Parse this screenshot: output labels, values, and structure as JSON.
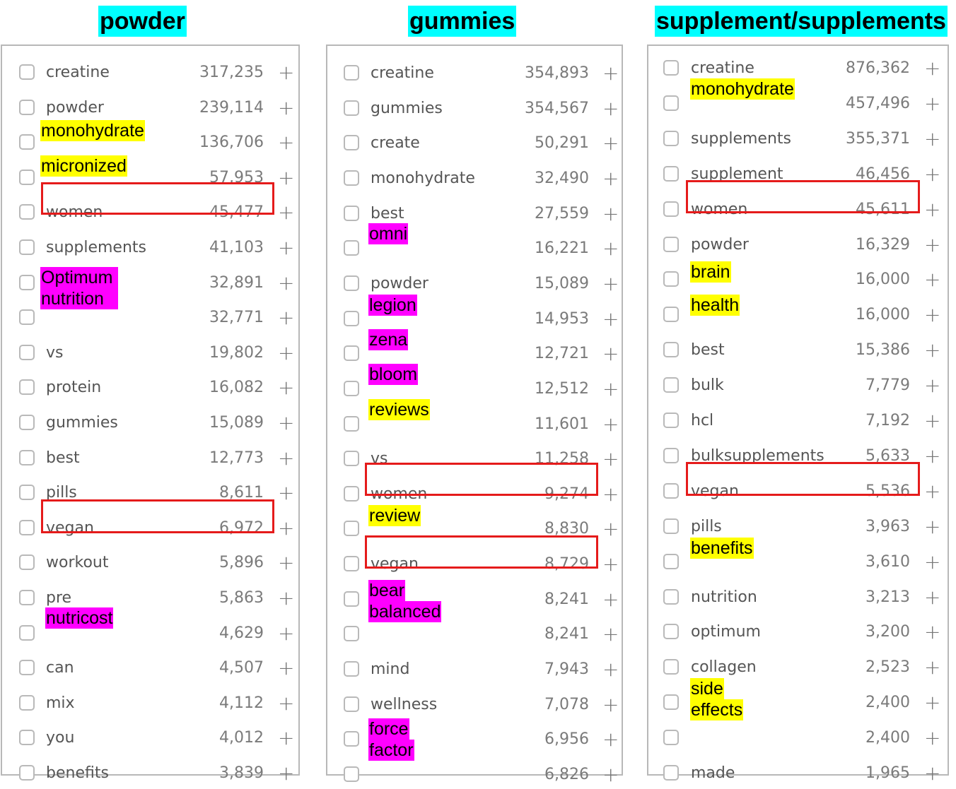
{
  "titles": {
    "powder": "powder",
    "gummies": "gummies",
    "supplements": "supplement/supplements"
  },
  "colors": {
    "title_bg": "#00ffff",
    "yellow": "#ffff00",
    "magenta": "#ff00ff",
    "red_box": "#e51b1b"
  },
  "icons": {
    "checkbox": "checkbox-icon",
    "add": "plus-icon"
  },
  "powder_rows": [
    {
      "keyword": "creatine",
      "count": "317,235"
    },
    {
      "keyword": "powder",
      "count": "239,114"
    },
    {
      "keyword": "",
      "count": "136,706"
    },
    {
      "keyword": "",
      "count": "57,953"
    },
    {
      "keyword": "women",
      "count": "45,477"
    },
    {
      "keyword": "supplements",
      "count": "41,103"
    },
    {
      "keyword": "",
      "count": "32,891"
    },
    {
      "keyword": "",
      "count": "32,771"
    },
    {
      "keyword": "vs",
      "count": "19,802"
    },
    {
      "keyword": "protein",
      "count": "16,082"
    },
    {
      "keyword": "gummies",
      "count": "15,089"
    },
    {
      "keyword": "best",
      "count": "12,773"
    },
    {
      "keyword": "pills",
      "count": "8,611"
    },
    {
      "keyword": "vegan",
      "count": "6,972"
    },
    {
      "keyword": "workout",
      "count": "5,896"
    },
    {
      "keyword": "pre",
      "count": "5,863"
    },
    {
      "keyword": "",
      "count": "4,629"
    },
    {
      "keyword": "can",
      "count": "4,507"
    },
    {
      "keyword": "mix",
      "count": "4,112"
    },
    {
      "keyword": "you",
      "count": "4,012"
    },
    {
      "keyword": "benefits",
      "count": "3,839"
    }
  ],
  "gummies_rows": [
    {
      "keyword": "creatine",
      "count": "354,893"
    },
    {
      "keyword": "gummies",
      "count": "354,567"
    },
    {
      "keyword": "create",
      "count": "50,291"
    },
    {
      "keyword": "monohydrate",
      "count": "32,490"
    },
    {
      "keyword": "best",
      "count": "27,559"
    },
    {
      "keyword": "",
      "count": "16,221"
    },
    {
      "keyword": "powder",
      "count": "15,089"
    },
    {
      "keyword": "",
      "count": "14,953"
    },
    {
      "keyword": "",
      "count": "12,721"
    },
    {
      "keyword": "",
      "count": "12,512"
    },
    {
      "keyword": "",
      "count": "11,601"
    },
    {
      "keyword": "vs",
      "count": "11,258"
    },
    {
      "keyword": "women",
      "count": "9,274"
    },
    {
      "keyword": "",
      "count": "8,830"
    },
    {
      "keyword": "vegan",
      "count": "8,729"
    },
    {
      "keyword": "",
      "count": "8,241"
    },
    {
      "keyword": "",
      "count": "8,241"
    },
    {
      "keyword": "mind",
      "count": "7,943"
    },
    {
      "keyword": "wellness",
      "count": "7,078"
    },
    {
      "keyword": "",
      "count": "6,956"
    },
    {
      "keyword": "",
      "count": "6,826"
    }
  ],
  "supplements_rows": [
    {
      "keyword": "creatine",
      "count": "876,362"
    },
    {
      "keyword": "",
      "count": "457,496"
    },
    {
      "keyword": "supplements",
      "count": "355,371"
    },
    {
      "keyword": "supplement",
      "count": "46,456"
    },
    {
      "keyword": "women",
      "count": "45,611"
    },
    {
      "keyword": "powder",
      "count": "16,329"
    },
    {
      "keyword": "",
      "count": "16,000"
    },
    {
      "keyword": "",
      "count": "16,000"
    },
    {
      "keyword": "best",
      "count": "15,386"
    },
    {
      "keyword": "bulk",
      "count": "7,779"
    },
    {
      "keyword": "hcl",
      "count": "7,192"
    },
    {
      "keyword": "bulksupplements",
      "count": "5,633"
    },
    {
      "keyword": "vegan",
      "count": "5,536"
    },
    {
      "keyword": "pills",
      "count": "3,963"
    },
    {
      "keyword": "",
      "count": "3,610"
    },
    {
      "keyword": "nutrition",
      "count": "3,213"
    },
    {
      "keyword": "optimum",
      "count": "3,200"
    },
    {
      "keyword": "collagen",
      "count": "2,523"
    },
    {
      "keyword": "",
      "count": "2,400"
    },
    {
      "keyword": "",
      "count": "2,400"
    },
    {
      "keyword": "made",
      "count": "1,965"
    }
  ],
  "highlights": {
    "powder_monohydrate": "monohydrate",
    "powder_micronized": "micronized",
    "powder_optimum": "Optimum \nnutrition",
    "powder_nutricost": "nutricost",
    "gummies_omni": "omni",
    "gummies_legion": "legion",
    "gummies_zena": "zena",
    "gummies_bloom": "bloom",
    "gummies_reviews": "reviews",
    "gummies_review": "review",
    "gummies_bear": "bear",
    "gummies_balanced": "balanced",
    "gummies_force": "force",
    "gummies_factor": "factor",
    "supp_monohydrate": "monohydrate",
    "supp_brain": "brain",
    "supp_health": "health",
    "supp_benefits": "benefits",
    "supp_side": "side",
    "supp_effects": "effects"
  }
}
